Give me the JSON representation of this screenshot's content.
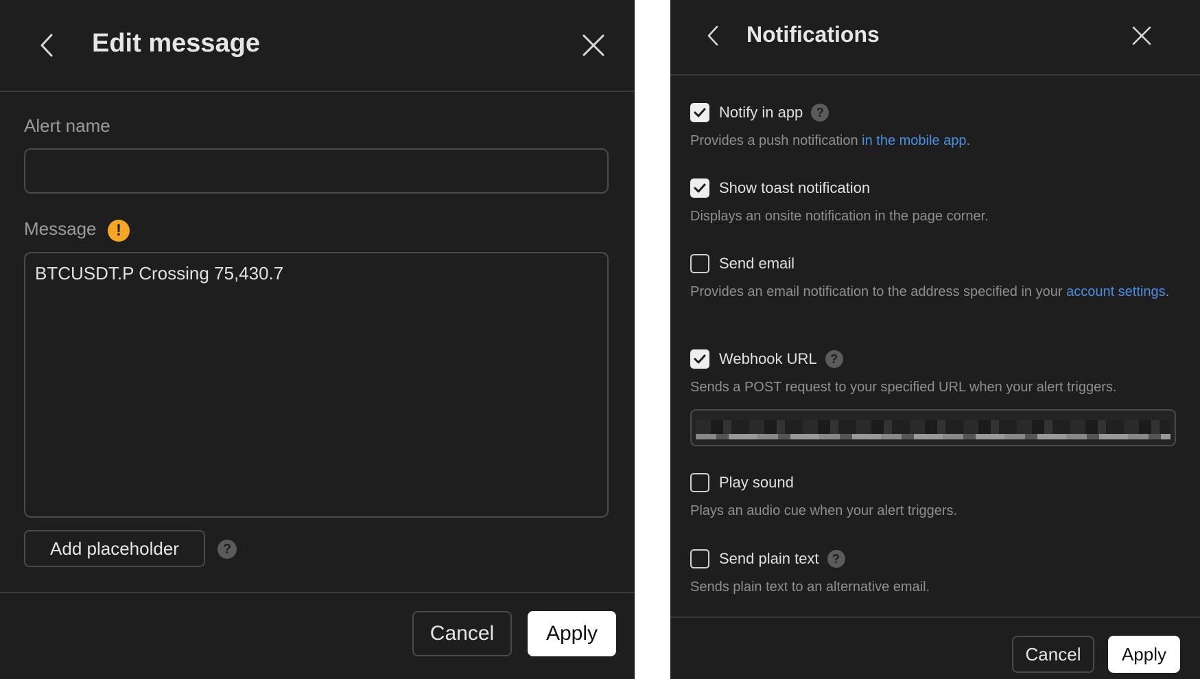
{
  "edit_message": {
    "title": "Edit message",
    "alert_name_label": "Alert name",
    "alert_name_value": "",
    "message_label": "Message",
    "message_value": "BTCUSDT.P Crossing 75,430.7",
    "add_placeholder_label": "Add placeholder",
    "cancel_label": "Cancel",
    "apply_label": "Apply",
    "icons": {
      "back": "chevron-left-icon",
      "close": "close-icon",
      "warning": "warning-icon",
      "help": "help-icon"
    }
  },
  "notifications": {
    "title": "Notifications",
    "options": [
      {
        "label": "Notify in app",
        "checked": true,
        "has_help": true,
        "desc": "Provides a push notification ",
        "link": "in the mobile app",
        "desc_after": "."
      },
      {
        "label": "Show toast notification",
        "checked": true,
        "has_help": false,
        "desc": "Displays an onsite notification in the page corner."
      },
      {
        "label": "Send email",
        "checked": false,
        "has_help": false,
        "desc": "Provides an email notification to the address specified in your ",
        "link": "account settings",
        "desc_after": "."
      },
      {
        "label": "Webhook URL",
        "checked": true,
        "has_help": true,
        "desc": "Sends a POST request to your specified URL when your alert triggers."
      },
      {
        "label": "Play sound",
        "checked": false,
        "has_help": false,
        "desc": "Plays an audio cue when your alert triggers."
      },
      {
        "label": "Send plain text",
        "checked": false,
        "has_help": true,
        "desc": "Sends plain text to an alternative email."
      }
    ],
    "webhook_url_value": "",
    "cancel_label": "Cancel",
    "apply_label": "Apply"
  },
  "colors": {
    "panel_bg": "#1e1e1e",
    "link": "#4a90e2",
    "warning": "#f5a623"
  }
}
